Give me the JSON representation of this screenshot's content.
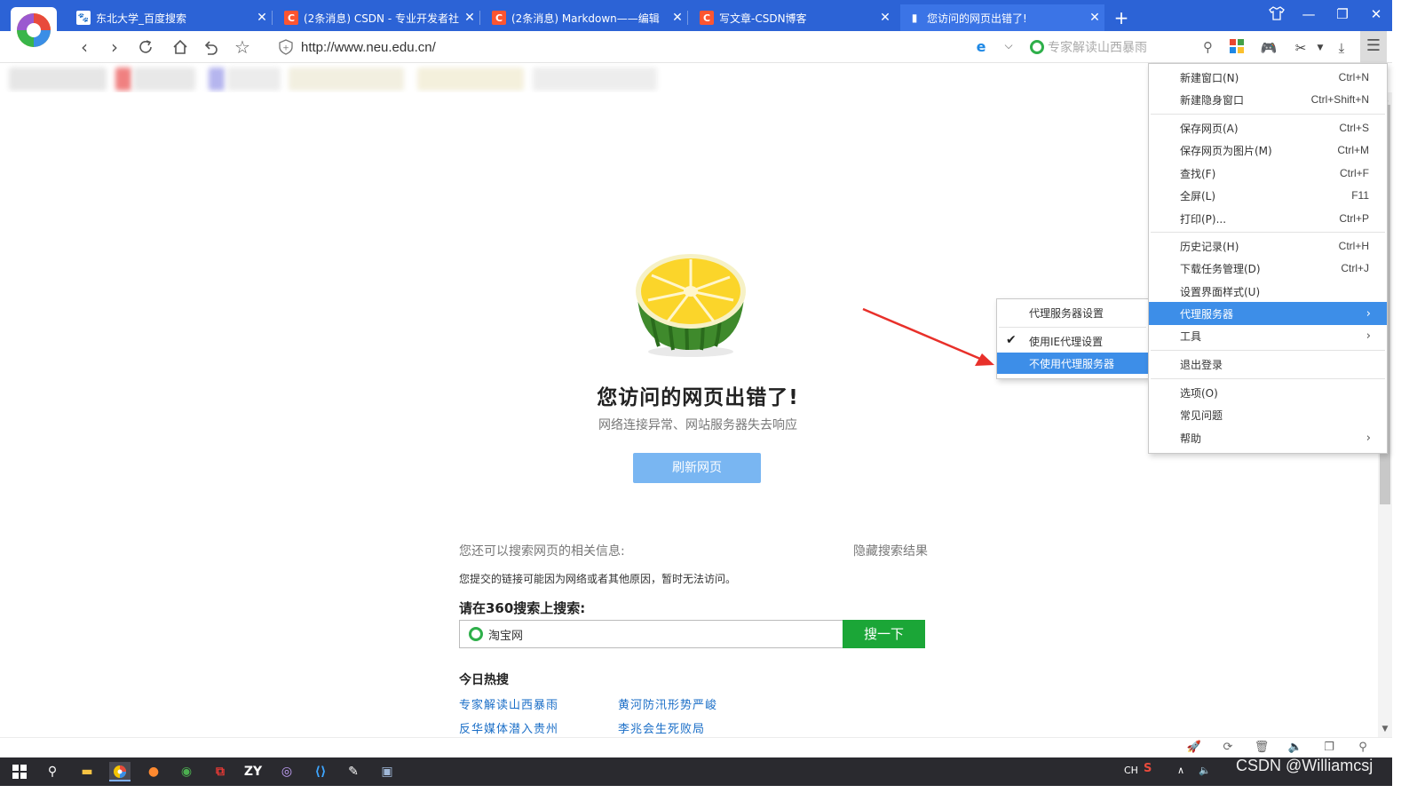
{
  "browser": {
    "tabs": [
      {
        "title": "东北大学_百度搜索",
        "favicon": "baidu-paw-icon"
      },
      {
        "title": "(2条消息) CSDN - 专业开发者社",
        "favicon": "csdn-c-icon"
      },
      {
        "title": "(2条消息) Markdown——编辑",
        "favicon": "csdn-c-icon"
      },
      {
        "title": "写文章-CSDN博客",
        "favicon": "csdn-c-icon"
      },
      {
        "title": "您访问的网页出错了!",
        "favicon": "document-icon"
      }
    ],
    "close_glyph": "✕",
    "new_tab_glyph": "+",
    "url": "http://www.neu.edu.cn/",
    "search_placeholder": "专家解读山西暴雨"
  },
  "error_page": {
    "title": "您访问的网页出错了!",
    "subtitle": "网络连接异常、网站服务器失去响应",
    "refresh_label": "刷新网页",
    "search_info": "您还可以搜索网页的相关信息:",
    "hide_results": "隐藏搜索结果",
    "reason": "您提交的链接可能因为网络或者其他原因，暂时无法访问。",
    "search_360_title": "请在360搜索上搜索:",
    "search_360_value": "淘宝网",
    "search_360_button": "搜一下",
    "hot_title": "今日热搜",
    "hot_links": [
      "专家解读山西暴雨",
      "黄河防汛形势严峻",
      "反华媒体潜入贵州",
      "李兆会生死败局"
    ]
  },
  "main_menu": {
    "items": [
      {
        "label": "新建窗口(N)",
        "shortcut": "Ctrl+N"
      },
      {
        "label": "新建隐身窗口",
        "shortcut": "Ctrl+Shift+N"
      },
      {
        "label": "保存网页(A)",
        "shortcut": "Ctrl+S"
      },
      {
        "label": "保存网页为图片(M)",
        "shortcut": "Ctrl+M"
      },
      {
        "label": "查找(F)",
        "shortcut": "Ctrl+F"
      },
      {
        "label": "全屏(L)",
        "shortcut": "F11"
      },
      {
        "label": "打印(P)...",
        "shortcut": "Ctrl+P"
      },
      {
        "label": "历史记录(H)",
        "shortcut": "Ctrl+H"
      },
      {
        "label": "下载任务管理(D)",
        "shortcut": "Ctrl+J"
      },
      {
        "label": "设置界面样式(U)",
        "shortcut": ""
      },
      {
        "label": "代理服务器",
        "shortcut": "",
        "highlighted": true
      },
      {
        "label": "工具",
        "shortcut": ""
      },
      {
        "label": "退出登录",
        "shortcut": ""
      },
      {
        "label": "选项(O)",
        "shortcut": ""
      },
      {
        "label": "常见问题",
        "shortcut": ""
      },
      {
        "label": "帮助",
        "shortcut": ""
      }
    ],
    "highlight_color": "#3d8ee8"
  },
  "proxy_submenu": {
    "items": [
      {
        "label": "代理服务器设置",
        "checked": false
      },
      {
        "label": "使用IE代理设置",
        "checked": true
      },
      {
        "label": "不使用代理服务器",
        "checked": false,
        "highlighted": true
      }
    ]
  },
  "taskbar": {
    "lang": "CH",
    "watermark": "CSDN @Williamcsj"
  },
  "colors": {
    "titlebar": "#2c63d6",
    "refresh_button": "#79b6f2",
    "search_button": "#1ba637",
    "link": "#1a6ec7",
    "annotation_arrow": "#e8302a"
  }
}
